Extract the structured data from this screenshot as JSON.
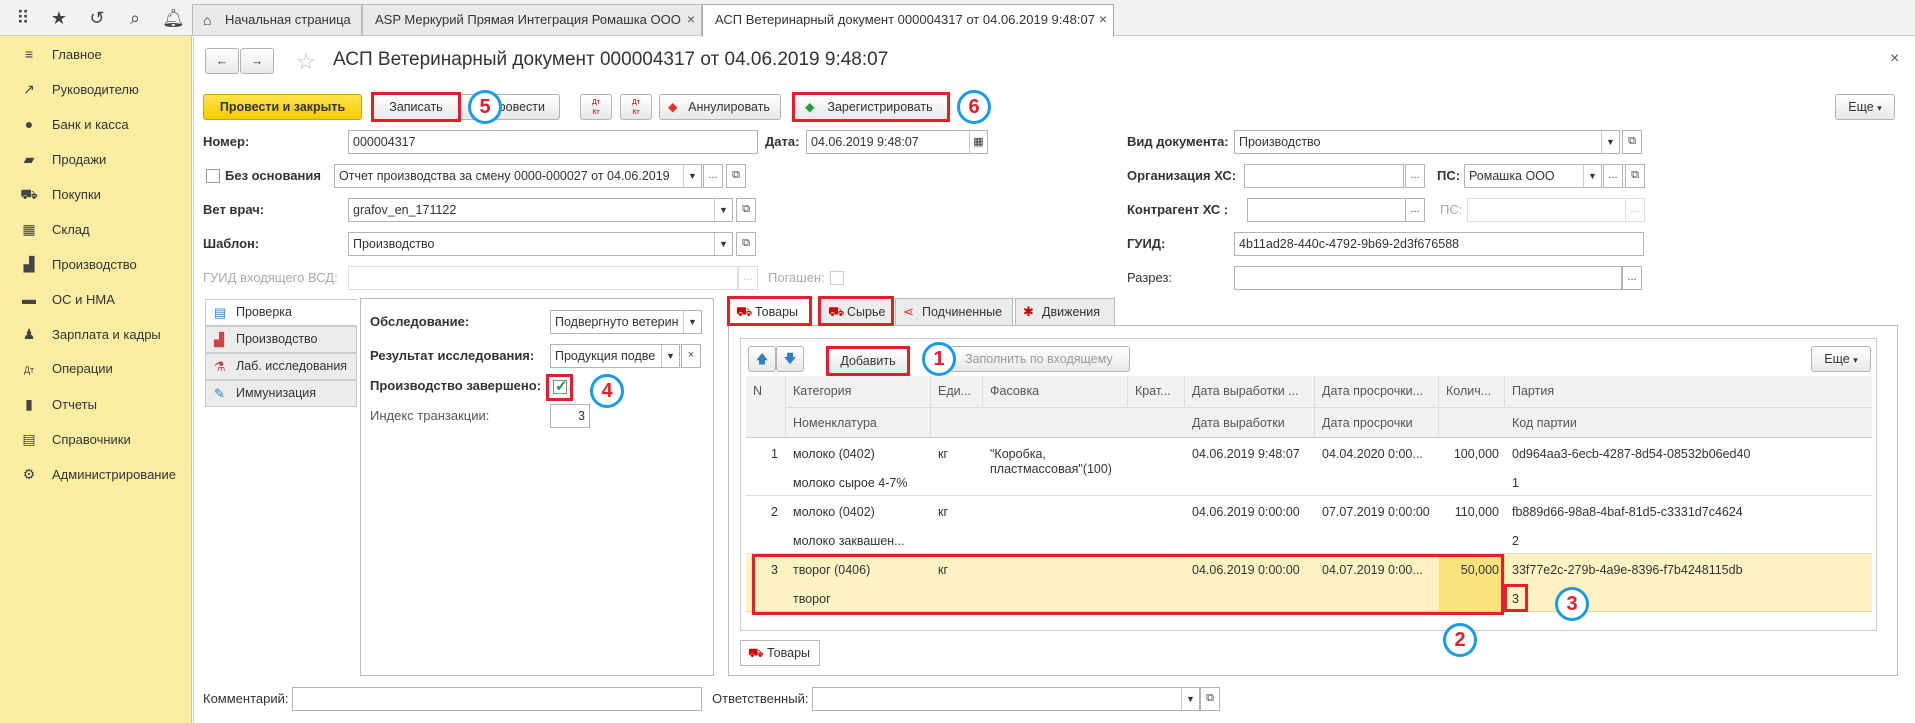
{
  "tabs": [
    {
      "label": "Начальная страница"
    },
    {
      "label": "ASP Меркурий Прямая Интеграция Ромашка ООО"
    },
    {
      "label": "АСП Ветеринарный документ 000004317 от 04.06.2019 9:48:07"
    }
  ],
  "sidebar": {
    "items": [
      {
        "label": "Главное"
      },
      {
        "label": "Руководителю"
      },
      {
        "label": "Банк и касса"
      },
      {
        "label": "Продажи"
      },
      {
        "label": "Покупки"
      },
      {
        "label": "Склад"
      },
      {
        "label": "Производство"
      },
      {
        "label": "ОС и НМА"
      },
      {
        "label": "Зарплата и кадры"
      },
      {
        "label": "Операции"
      },
      {
        "label": "Отчеты"
      },
      {
        "label": "Справочники"
      },
      {
        "label": "Администрирование"
      }
    ]
  },
  "page": {
    "title": "АСП Ветеринарный документ 000004317 от 04.06.2019 9:48:07"
  },
  "toolbar": {
    "post_close": "Провести и закрыть",
    "save": "Записать",
    "post": "ровести",
    "dt1": "Дт\nКт",
    "annul": "Аннулировать",
    "register": "Зарегистрировать",
    "more": "Еще"
  },
  "form": {
    "number_label": "Номер:",
    "number": "000004317",
    "date_label": "Дата:",
    "date": "04.06.2019  9:48:07",
    "no_basis_label": "Без основания",
    "basis": "Отчет производства за смену 0000-000027 от 04.06.2019",
    "vet_label": "Вет врач:",
    "vet": "grafov_en_171122",
    "template_label": "Шаблон:",
    "template": "Производство",
    "guid_in_label": "ГУИД входящего ВСД:",
    "repaid_label": "Погашен:",
    "doc_type_label": "Вид документа:",
    "doc_type": "Производство",
    "org_label": "Организация ХС:",
    "ps_label": "ПС:",
    "ps": "Ромашка ООО",
    "contr_label": "Контрагент ХС  :",
    "ps2_label": "ПС:",
    "guid_label": "ГУИД:",
    "guid": "4b11ad28-440c-4792-9b69-2d3f676588",
    "section_label": "Разрез:"
  },
  "left_tabs": [
    {
      "label": "Проверка"
    },
    {
      "label": "Производство"
    },
    {
      "label": "Лаб. исследования"
    },
    {
      "label": "Иммунизация"
    }
  ],
  "inspection": {
    "survey_label": "Обследование:",
    "survey": "Подвергнуто ветерин",
    "result_label": "Результат исследования:",
    "result": "Продукция подве",
    "done_label": "Производство завершено:",
    "index_label": "Индекс транзакции:",
    "index": "3"
  },
  "right_tabs": [
    {
      "label": "Товары"
    },
    {
      "label": "Сырье"
    },
    {
      "label": "Подчиненные"
    },
    {
      "label": "Движения"
    }
  ],
  "table_toolbar": {
    "add": "Добавить",
    "fill": "Заполнить по входящему",
    "more": "Еще"
  },
  "table": {
    "headers_top": [
      "N",
      "Категория",
      "Еди...",
      "Фасовка",
      "Крат...",
      "Дата выработки ...",
      "Дата просрочки...",
      "Колич...",
      "Партия"
    ],
    "headers_bottom": [
      "Номенклатура",
      "Дата выработки",
      "Дата просрочки",
      "Код партии"
    ],
    "rows": [
      {
        "n": "1",
        "cat": "молоко (0402)",
        "nom": "молоко сырое 4-7%",
        "unit": "кг",
        "pack": "\"Коробка, пластмассовая\"(100)",
        "d1": "04.06.2019 9:48:07",
        "d2": "04.04.2020 0:00...",
        "qty": "100,000",
        "batch": "0d964aa3-6ecb-4287-8d54-08532b06ed40",
        "code": "1"
      },
      {
        "n": "2",
        "cat": "молоко (0402)",
        "nom": "молоко заквашен...",
        "unit": "кг",
        "pack": "",
        "d1": "04.06.2019 0:00:00",
        "d2": "07.07.2019 0:00:00",
        "qty": "110,000",
        "batch": "fb889d66-98a8-4baf-81d5-c3331d7c4624",
        "code": "2"
      },
      {
        "n": "3",
        "cat": "творог (0406)",
        "nom": "творог",
        "unit": "кг",
        "pack": "",
        "d1": "04.06.2019 0:00:00",
        "d2": "04.07.2019 0:00...",
        "qty": "50,000",
        "batch": "33f77e2c-279b-4a9e-8396-f7b4248115db",
        "code": "3"
      }
    ]
  },
  "bottom_tab": "Товары",
  "footer": {
    "comment_label": "Комментарий:",
    "responsible_label": "Ответственный:"
  },
  "badges": [
    "1",
    "2",
    "3",
    "4",
    "5",
    "6"
  ],
  "colors": {
    "sidebar": "#fbeda2",
    "accent": "#f6cc00",
    "highlight": "#e0202a",
    "badge_ring": "#1a9be6",
    "row_selected": "#fdf2c2"
  }
}
